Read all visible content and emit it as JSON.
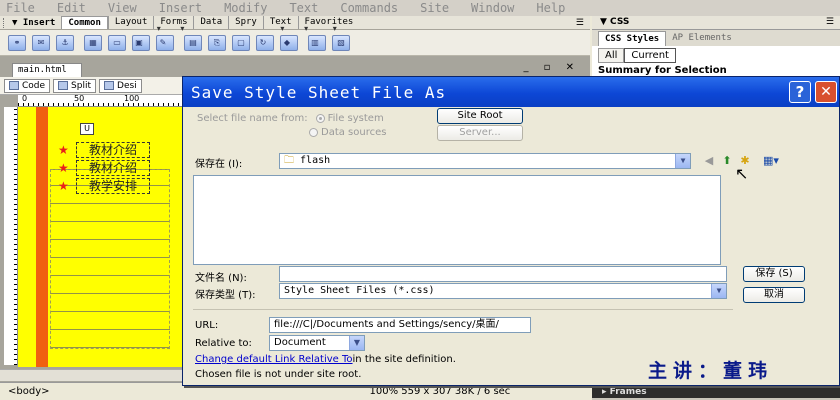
{
  "menubar": [
    "File",
    "Edit",
    "View",
    "Insert",
    "Modify",
    "Text",
    "Commands",
    "Site",
    "Window",
    "Help"
  ],
  "insert_bar": {
    "title": "▼ Insert",
    "tabs": [
      "Common",
      "Layout",
      "Forms",
      "Data",
      "Spry",
      "Text",
      "Favorites"
    ],
    "active_tab": "Common"
  },
  "document": {
    "tab": "main.html",
    "view_buttons": [
      "Code",
      "Split",
      "Desi"
    ],
    "ruler_marks": [
      "0",
      "50",
      "100"
    ],
    "nav_items": [
      "教材介绍",
      "教材介绍",
      "教学安排"
    ],
    "status_tag": "<body>",
    "status_partial": "100%   559 x 307   38K / 6 sec"
  },
  "right_panel": {
    "header": "▼ CSS",
    "tabs": [
      "CSS Styles",
      "AP Elements"
    ],
    "buttons": [
      "All",
      "Current"
    ],
    "summary": "Summary for Selection",
    "frames": "▸ Frames"
  },
  "dialog": {
    "title": "Save Style Sheet File As",
    "help": "?",
    "close": "✕",
    "select_from_label": "Select file name from:",
    "option_filesystem": "File system",
    "option_datasources": "Data sources",
    "site_root_button": "Site Root",
    "server_button": "Server...",
    "save_in_label": "保存在 (I):",
    "save_in_value": "flash",
    "filename_label": "文件名 (N):",
    "filename_value": "",
    "filetype_label": "保存类型 (T):",
    "filetype_value": "Style Sheet Files (*.css)",
    "save_button": "保存 (S)",
    "cancel_button": "取消",
    "url_label": "URL:",
    "url_value": "file:///C|/Documents and Settings/sency/桌面/",
    "relative_label": "Relative to:",
    "relative_value": "Document",
    "change_link": "Change default Link Relative To",
    "change_suffix": " in the site definition.",
    "note": "Chosen file is not under site root."
  },
  "watermark": "主讲：董玮",
  "colors": {
    "titlebar": "#0d47d6",
    "canvas": "#ffff00",
    "accent_strip": "#f06010"
  }
}
